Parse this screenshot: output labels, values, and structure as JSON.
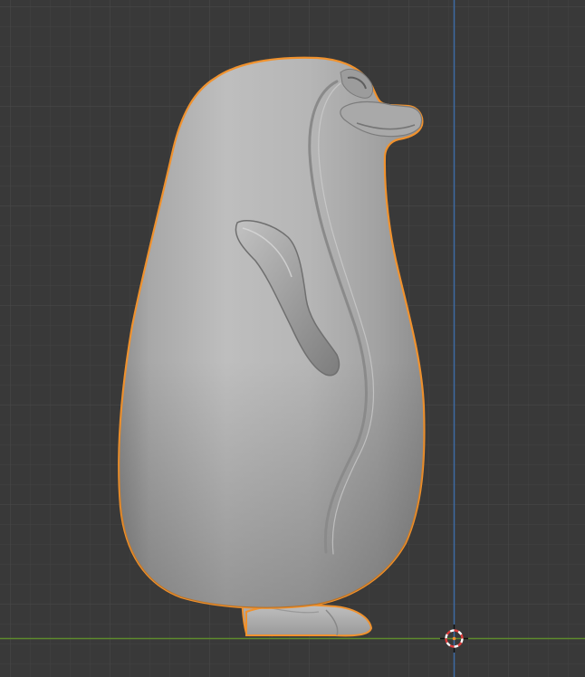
{
  "viewport": {
    "view": "side",
    "background_color": "#393939",
    "grid_minor_color": "#434343",
    "grid_major_color": "#4c4c4c",
    "x_axis_color": "#5f8a2a",
    "z_axis_color": "#3a6aa8"
  },
  "object": {
    "name": "penguin",
    "selected": true,
    "outline_color": "#f0922e",
    "body_color": "#b9b9b9"
  },
  "cursor_3d": {
    "icon": "3d-cursor-icon"
  }
}
